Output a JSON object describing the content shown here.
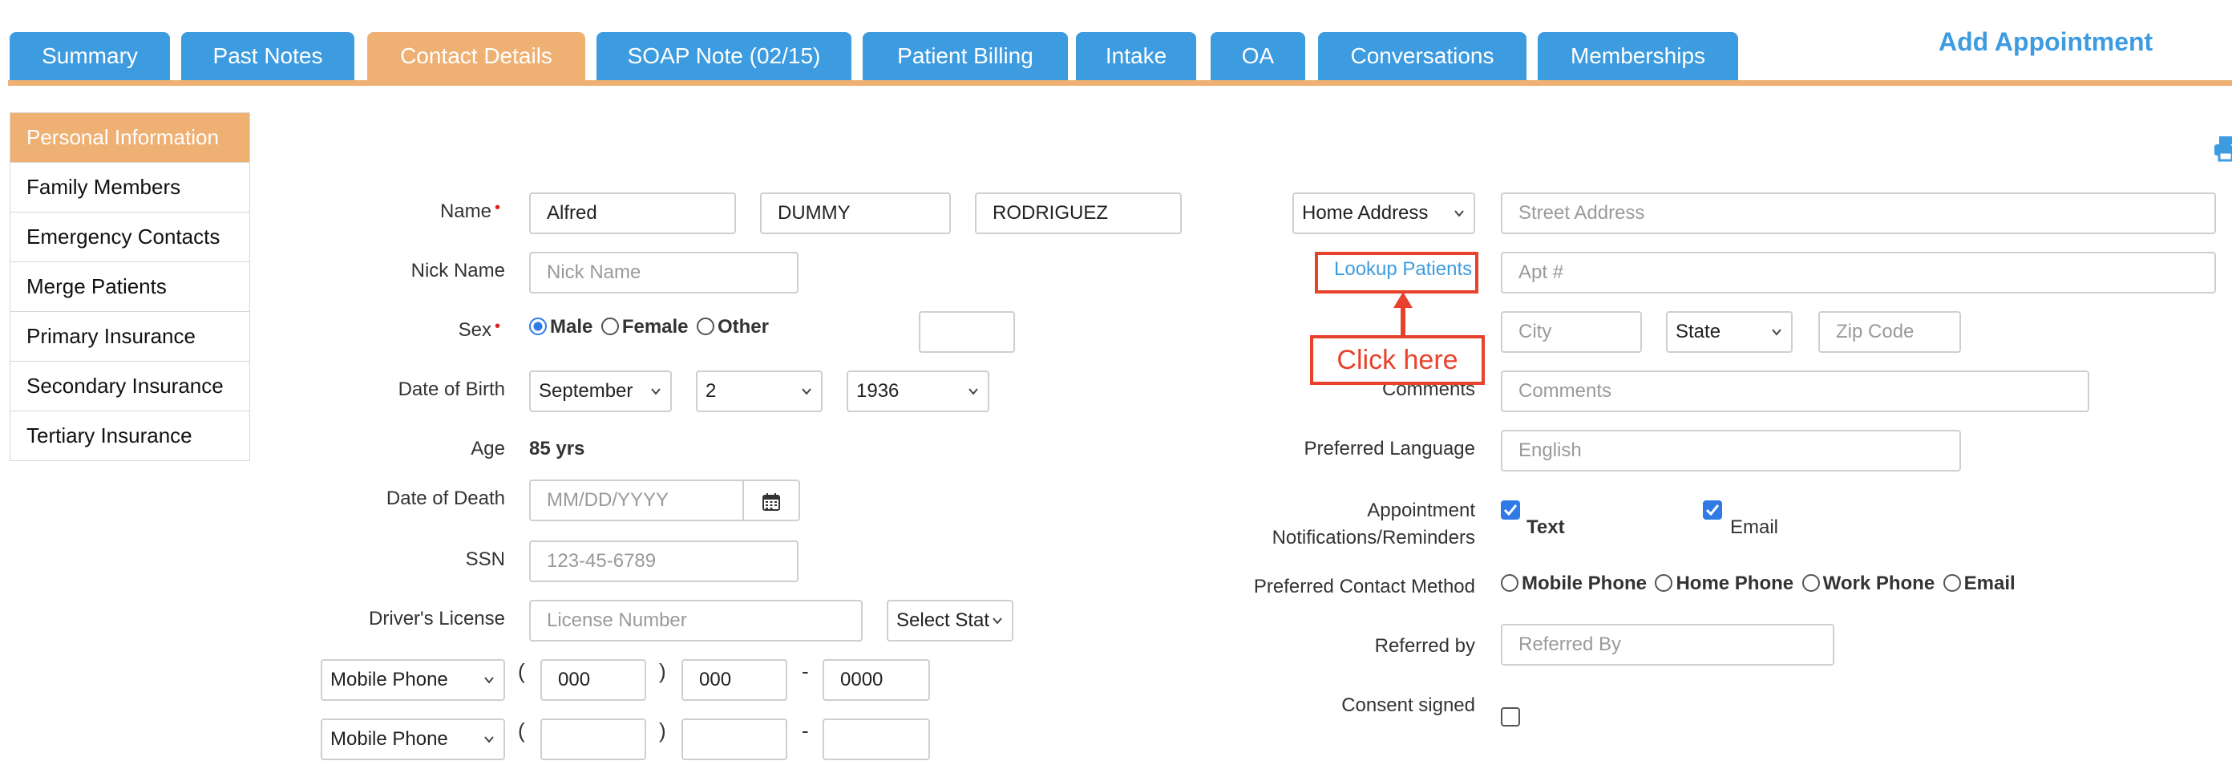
{
  "tabs": [
    {
      "label": "Summary",
      "active": false
    },
    {
      "label": "Past Notes",
      "active": false
    },
    {
      "label": "Contact Details",
      "active": true
    },
    {
      "label": "SOAP Note (02/15)",
      "active": false
    },
    {
      "label": "Patient Billing",
      "active": false
    },
    {
      "label": "Intake",
      "active": false
    },
    {
      "label": "OA",
      "active": false
    },
    {
      "label": "Conversations",
      "active": false
    },
    {
      "label": "Memberships",
      "active": false
    }
  ],
  "add_appointment": "Add Appointment",
  "sidebar": {
    "items": [
      {
        "label": "Personal Information",
        "active": true
      },
      {
        "label": "Family Members"
      },
      {
        "label": "Emergency Contacts"
      },
      {
        "label": "Merge Patients"
      },
      {
        "label": "Primary Insurance"
      },
      {
        "label": "Secondary Insurance"
      },
      {
        "label": "Tertiary Insurance"
      }
    ]
  },
  "left_form": {
    "name_label": "Name",
    "first_name": "Alfred",
    "middle_name": "DUMMY",
    "last_name": "RODRIGUEZ",
    "nick_label": "Nick Name",
    "nick_placeholder": "Nick Name",
    "sex_label": "Sex",
    "sex_options": [
      "Male",
      "Female",
      "Other"
    ],
    "sex_selected": "Male",
    "dob_label": "Date of Birth",
    "dob_month": "September",
    "dob_day": "2",
    "dob_year": "1936",
    "age_label": "Age",
    "age_value": "85 yrs",
    "dod_label": "Date of Death",
    "dod_placeholder": "MM/DD/YYYY",
    "ssn_label": "SSN",
    "ssn_placeholder": "123-45-6789",
    "dl_label": "Driver's License",
    "dl_placeholder": "License Number",
    "dl_state": "Select Stat",
    "phone1_type": "Mobile Phone",
    "phone1_area": "000",
    "phone1_prefix": "000",
    "phone1_line": "0000",
    "phone2_type": "Mobile Phone",
    "paren_open": "(",
    "paren_close": ")",
    "dash": "-"
  },
  "right_form": {
    "address_type": "Home Address",
    "street_placeholder": "Street Address",
    "lookup_link": "Lookup Patients",
    "apt_placeholder": "Apt #",
    "city_placeholder": "City",
    "state_value": "State",
    "zip_placeholder": "Zip Code",
    "comments_label": "Comments",
    "comments_placeholder": "Comments",
    "lang_label": "Preferred Language",
    "lang_placeholder": "English",
    "notif_label_line1": "Appointment",
    "notif_label_line2": "Notifications/Reminders",
    "notif_text": "Text",
    "notif_text_checked": true,
    "notif_email": "Email",
    "notif_email_checked": true,
    "contact_method_label": "Preferred Contact Method",
    "contact_methods": [
      "Mobile Phone",
      "Home Phone",
      "Work Phone",
      "Email"
    ],
    "referred_label": "Referred by",
    "referred_placeholder": "Referred By",
    "consent_label": "Consent signed",
    "consent_checked": false
  },
  "annotation": {
    "callout_text": "Click here",
    "color": "#e8412c"
  },
  "colors": {
    "tab_blue": "#3d9be0",
    "tab_active": "#efb074",
    "check_blue": "#2f7ae5"
  },
  "icons": [
    "chevron-down-icon",
    "calendar-icon",
    "print-icon",
    "arrow-up-icon"
  ]
}
